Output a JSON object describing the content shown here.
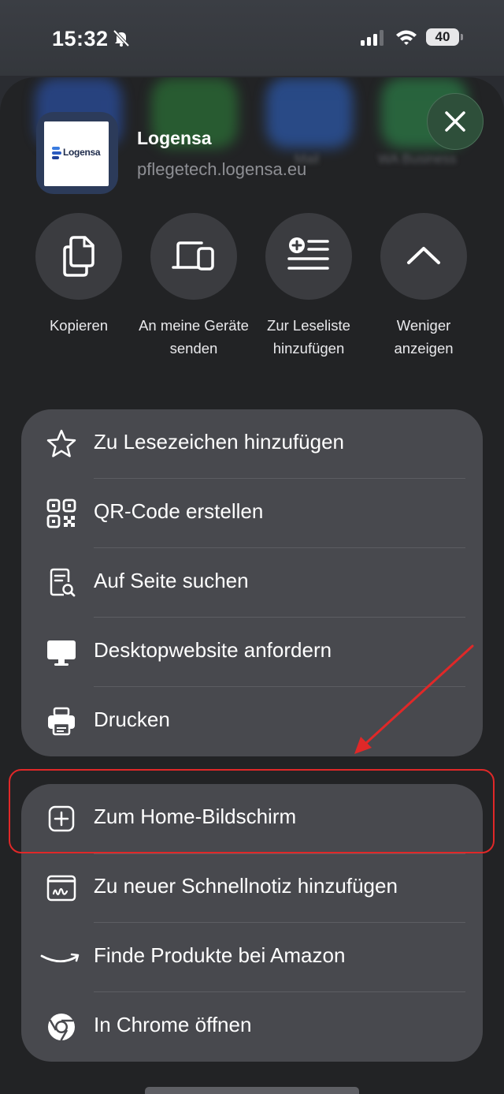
{
  "status_bar": {
    "time": "15:32",
    "battery": "40"
  },
  "share_header": {
    "title": "Logensa",
    "url": "pflegetech.logensa.eu",
    "logo_text": "Logensa"
  },
  "background_apps": [
    "Mail",
    "WA Business"
  ],
  "actions": [
    {
      "label": "Kopieren",
      "icon": "copy-icon"
    },
    {
      "label": "An meine Geräte senden",
      "icon": "devices-icon"
    },
    {
      "label": "Zur Leseliste hinzufügen",
      "icon": "reading-list-add-icon"
    },
    {
      "label": "Weniger anzeigen",
      "icon": "chevron-up-icon"
    }
  ],
  "menu_group_1": [
    {
      "label": "Zu Lesezeichen hinzufügen",
      "icon": "star-icon"
    },
    {
      "label": "QR-Code erstellen",
      "icon": "qr-code-icon"
    },
    {
      "label": "Auf Seite suchen",
      "icon": "find-on-page-icon"
    },
    {
      "label": "Desktopwebsite anfordern",
      "icon": "desktop-icon"
    },
    {
      "label": "Drucken",
      "icon": "printer-icon"
    }
  ],
  "menu_group_2": [
    {
      "label": "Zum Home-Bildschirm",
      "icon": "add-square-icon"
    },
    {
      "label": "Zu neuer Schnellnotiz hinzufügen",
      "icon": "quick-note-icon"
    },
    {
      "label": "Finde Produkte bei Amazon",
      "icon": "amazon-icon"
    },
    {
      "label": "In Chrome öffnen",
      "icon": "chrome-icon"
    }
  ],
  "colors": {
    "annotation": "#e02828",
    "sheet": "#222325",
    "group": "#48494e"
  }
}
